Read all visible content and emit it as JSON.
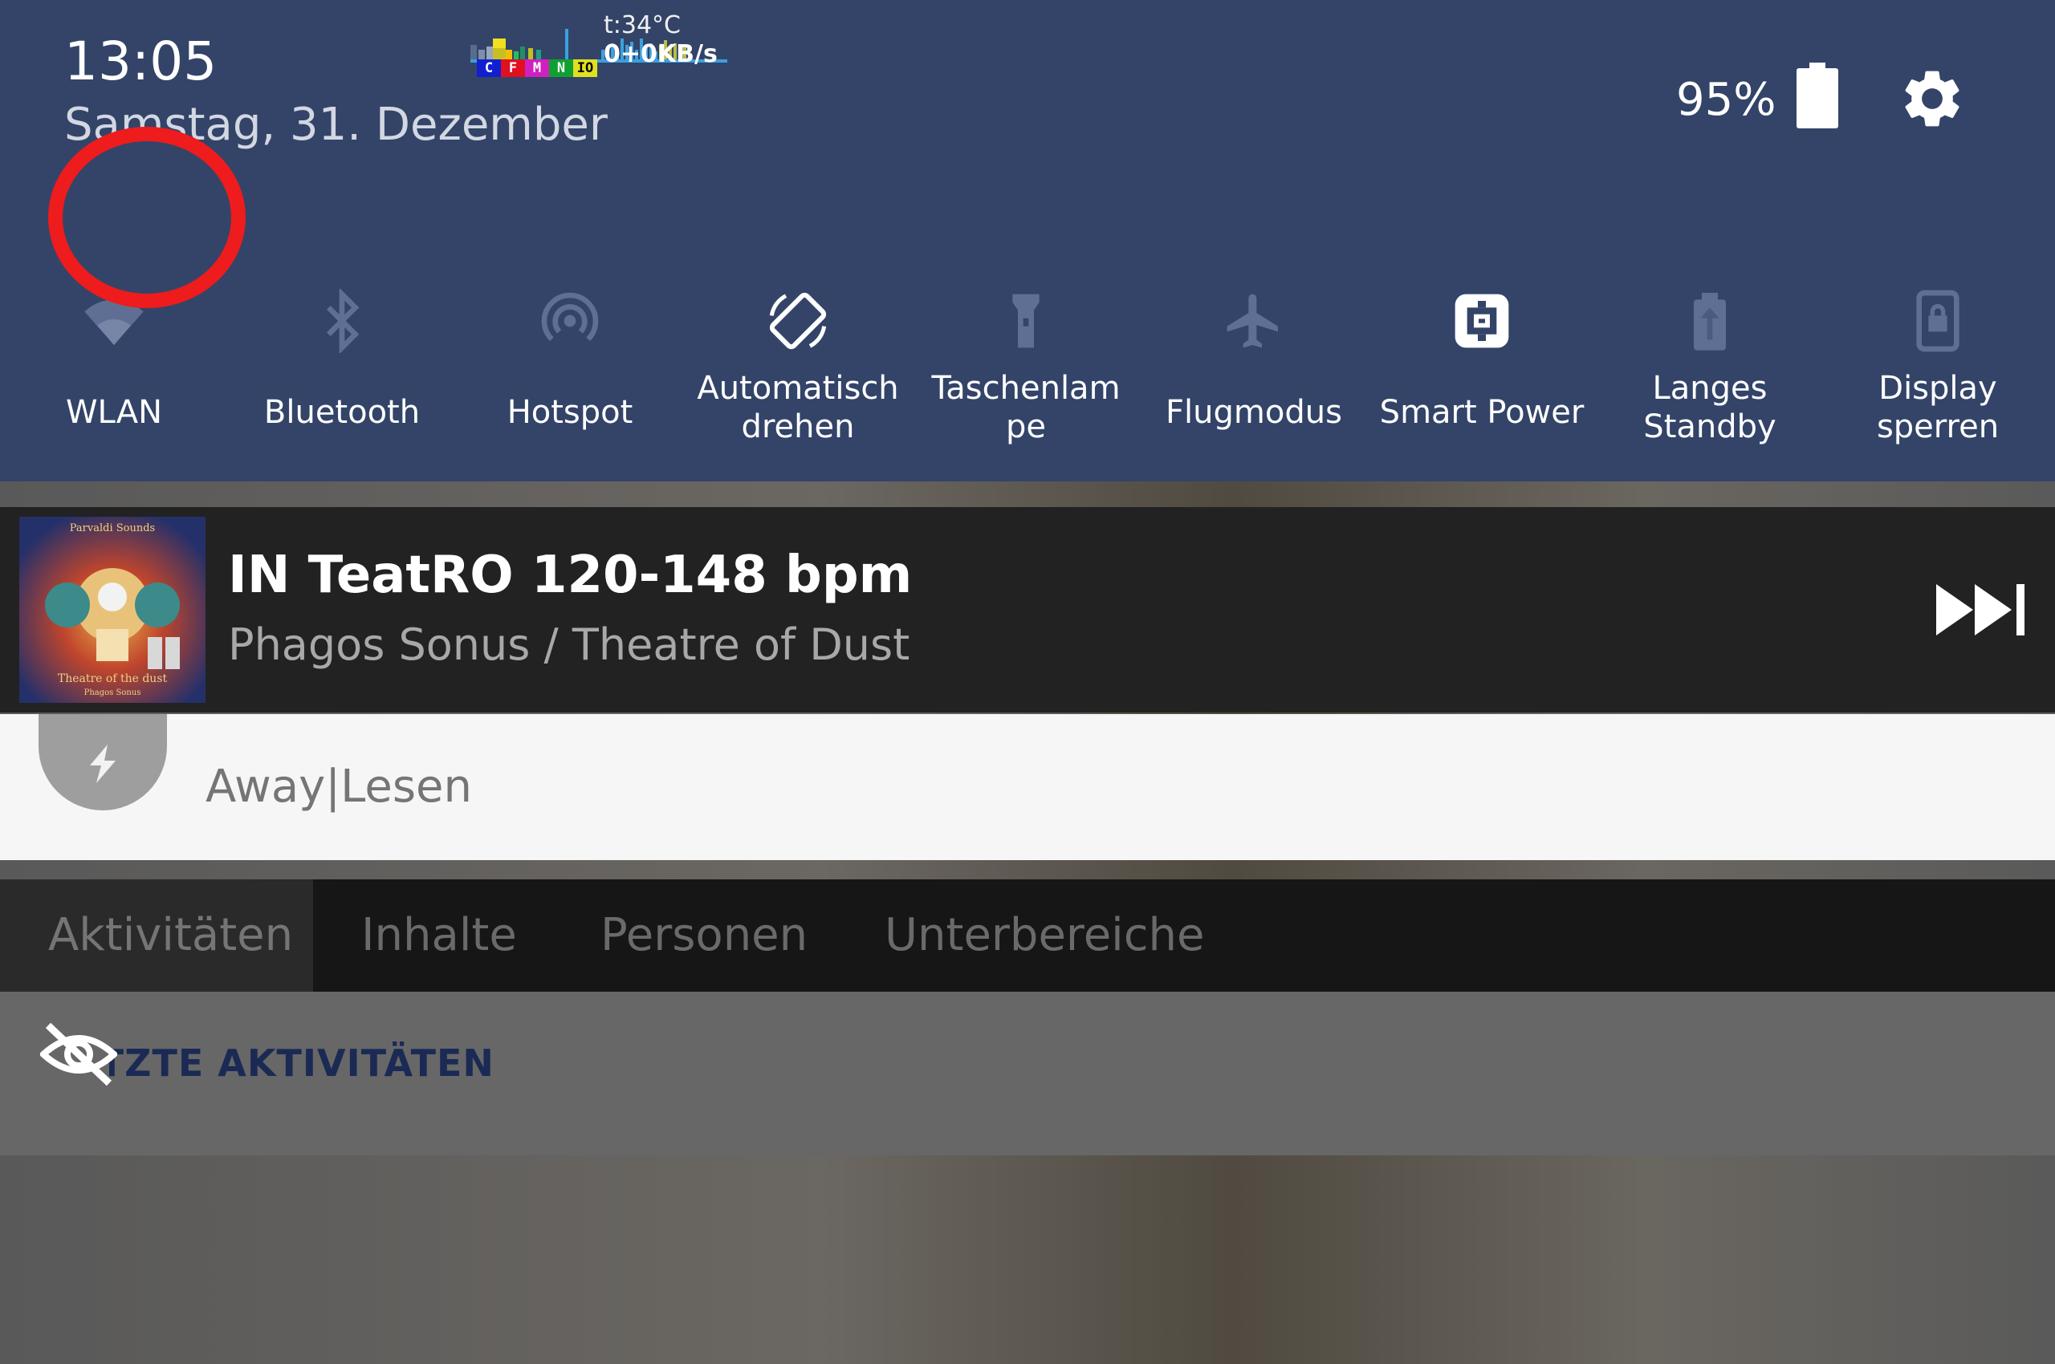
{
  "status": {
    "time": "13:05",
    "date": "Samstag, 31. Dezember",
    "battery_percent": "95%"
  },
  "system_monitor": {
    "cpu_labels": [
      "C",
      "F",
      "M",
      "N",
      "IO"
    ],
    "temperature": "t:34°C",
    "network": "0+0KB/s"
  },
  "tiles": [
    {
      "label": "WLAN",
      "icon": "wifi-icon",
      "active": false
    },
    {
      "label": "Bluetooth",
      "icon": "bluetooth-icon",
      "active": false
    },
    {
      "label": "Hotspot",
      "icon": "hotspot-icon",
      "active": false
    },
    {
      "label": "Automatisch drehen",
      "icon": "auto-rotate-icon",
      "active": true
    },
    {
      "label": "Taschenlampe",
      "icon": "flashlight-icon",
      "active": false
    },
    {
      "label": "Flugmodus",
      "icon": "airplane-icon",
      "active": false
    },
    {
      "label": "Smart Power",
      "icon": "smart-power-icon",
      "active": true
    },
    {
      "label": "Langes Standby",
      "icon": "standby-icon",
      "active": false
    },
    {
      "label": "Display sperren",
      "icon": "lock-display-icon",
      "active": false
    }
  ],
  "tile_lines": {
    "t0": [
      "WLAN"
    ],
    "t1": [
      "Bluetooth"
    ],
    "t2": [
      "Hotspot"
    ],
    "t3": [
      "Automatisch",
      "drehen"
    ],
    "t4": [
      "Taschenlam",
      "pe"
    ],
    "t5": [
      "Flugmodus"
    ],
    "t6": [
      "Smart Power"
    ],
    "t7": [
      "Langes",
      "Standby"
    ],
    "t8": [
      "Display",
      "sperren"
    ]
  },
  "media": {
    "title": "IN TeatRO 120-148 bpm",
    "subtitle": "Phagos Sonus / Theatre of Dust",
    "album_text_top": "Parvaldi Sounds",
    "album_text_bottom": "Theatre of the dust",
    "album_text_artist": "Phagos Sonus"
  },
  "notification": {
    "text": "Away|Lesen"
  },
  "tabs": [
    "Aktivitäten",
    "Inhalte",
    "Personen",
    "Unterbereiche"
  ],
  "section": {
    "heading": "LETZTE AKTIVITÄTEN"
  },
  "colors": {
    "panel": "#334468",
    "active_tile": "#ffffff",
    "inactive_tile": "#5f6f93",
    "highlight_ring": "#ee1c1c"
  }
}
